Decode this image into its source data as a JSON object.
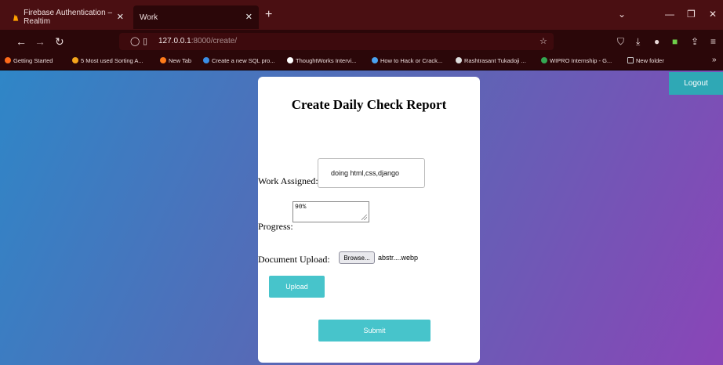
{
  "browser": {
    "tabs": [
      {
        "label": "Firebase Authentication – Realtim",
        "active": false
      },
      {
        "label": "Work",
        "active": true
      }
    ],
    "url_host": "127.0.0.1",
    "url_path": ":8000/create/",
    "bookmarks": [
      {
        "label": "Getting Started",
        "color": "#ff6a1a"
      },
      {
        "label": "5 Most used Sorting A...",
        "color": "#f4a51c"
      },
      {
        "label": "New Tab",
        "color": "#ff7b1a"
      },
      {
        "label": "Create a new SQL pro...",
        "color": "#3a8ee6"
      },
      {
        "label": "ThoughtWorks Intervi...",
        "color": "#ffffff"
      },
      {
        "label": "How to Hack or Crack...",
        "color": "#4aa3f0"
      },
      {
        "label": "Rashtrasant Tukadoji ...",
        "color": "#dddddd"
      },
      {
        "label": "WIPRO Internship - G...",
        "color": "#34a853"
      },
      {
        "label": "New folder",
        "color": "#cccccc"
      }
    ]
  },
  "header": {
    "logout_label": "Logout"
  },
  "form": {
    "title": "Create Daily Check Report",
    "work_label": "Work Assigned:",
    "work_value": "doing html,css,django",
    "progress_label": "Progress:",
    "progress_value": "90%",
    "doc_label": "Document Upload:",
    "browse_label": "Browse...",
    "file_name": "abstr....webp",
    "upload_label": "Upload",
    "submit_label": "Submit"
  },
  "colors": {
    "accent": "#47c4cb",
    "logout": "#2fa8b5",
    "chrome": "#4a0f12"
  }
}
